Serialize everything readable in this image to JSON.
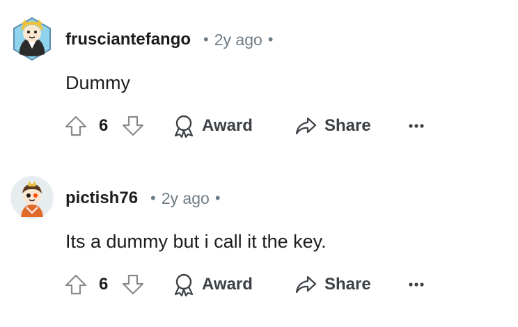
{
  "comments": [
    {
      "username": "frusciantefango",
      "time": "2y ago",
      "text": "Dummy",
      "votes": "6",
      "award_label": "Award",
      "share_label": "Share"
    },
    {
      "username": "pictish76",
      "time": "2y ago",
      "text": "Its a dummy but i call it the key.",
      "votes": "6",
      "award_label": "Award",
      "share_label": "Share"
    }
  ],
  "separator": "•",
  "icons": {
    "upvote": "arrow-up-icon",
    "downvote": "arrow-down-icon",
    "award": "award-ribbon-icon",
    "share": "share-arrow-icon",
    "more": "ellipsis-icon"
  }
}
